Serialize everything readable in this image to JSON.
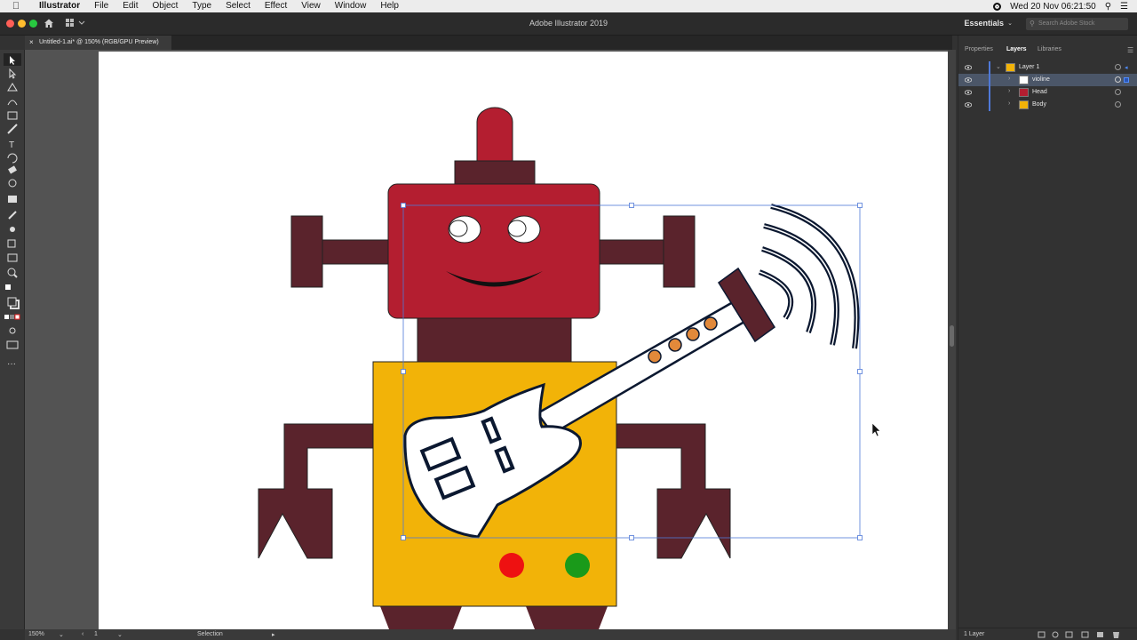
{
  "menubar": {
    "app_name": "Illustrator",
    "items": [
      "File",
      "Edit",
      "Object",
      "Type",
      "Select",
      "Effect",
      "View",
      "Window",
      "Help"
    ],
    "datetime": "Wed 20 Nov  06:21:50"
  },
  "window": {
    "title": "Adobe Illustrator 2019",
    "workspace": "Essentials",
    "search_placeholder": "Search Adobe Stock"
  },
  "document_tab": {
    "label": "Untitled-1.ai* @ 150% (RGB/GPU Preview)"
  },
  "statusbar": {
    "zoom": "150%",
    "artboard_number": "1",
    "tool_name": "Selection"
  },
  "panel": {
    "tabs": [
      "Properties",
      "Layers",
      "Libraries"
    ],
    "active_tab": "Layers",
    "layers": [
      {
        "label": "Layer 1",
        "level": 0,
        "selected": false
      },
      {
        "label": "violine",
        "level": 1,
        "selected": true
      },
      {
        "label": "Head",
        "level": 1,
        "selected": false
      },
      {
        "label": "Body",
        "level": 1,
        "selected": false
      }
    ],
    "footer_count": "1 Layer"
  },
  "colors": {
    "robot_red": "#b41e30",
    "robot_brown": "#5a232c",
    "robot_yellow": "#f2b308",
    "selection_blue": "#4f79d8",
    "button_red": "#ee1111",
    "button_green": "#1a9a1a"
  },
  "icons": [
    "apple-icon",
    "home-icon",
    "workspace-switcher-icon",
    "search-icon",
    "eye-icon",
    "chevron-right-icon",
    "close-icon"
  ]
}
